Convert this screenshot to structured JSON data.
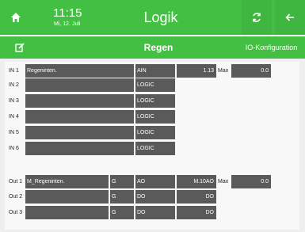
{
  "header": {
    "time": "11:15",
    "date": "Mi, 12. Juli",
    "title": "Logik",
    "home_icon": "home-icon",
    "sync_icon": "sync-icon",
    "back_icon": "back-arrow-icon"
  },
  "subheader": {
    "edit_icon": "edit-icon",
    "title": "Regen",
    "config_label": "IO-Konfiguration"
  },
  "inputs": [
    {
      "label": "IN 1",
      "name": "Regeninten.",
      "type": "AIN",
      "value": "1.13",
      "max_label": "Max",
      "max_value": "0.0"
    },
    {
      "label": "IN 2",
      "name": "",
      "type": "LOGIC"
    },
    {
      "label": "IN 3",
      "name": "",
      "type": "LOGIC"
    },
    {
      "label": "IN 4",
      "name": "",
      "type": "LOGIC"
    },
    {
      "label": "IN 5",
      "name": "",
      "type": "LOGIC"
    },
    {
      "label": "IN 6",
      "name": "",
      "type": "LOGIC"
    }
  ],
  "outputs": [
    {
      "label": "Out 1",
      "name": "M_Regeninten.",
      "g": "G",
      "type": "AO",
      "value": "M.10AO",
      "max_label": "Max",
      "max_value": "0.0"
    },
    {
      "label": "Out 2",
      "name": "",
      "g": "G",
      "type": "DO",
      "value": "DO"
    },
    {
      "label": "Out 3",
      "name": "",
      "g": "G",
      "type": "DO",
      "value": "DO"
    }
  ],
  "colors": {
    "accent_green": "#43c043",
    "cell_gray": "#5a5a5a",
    "background": "#efefef"
  }
}
